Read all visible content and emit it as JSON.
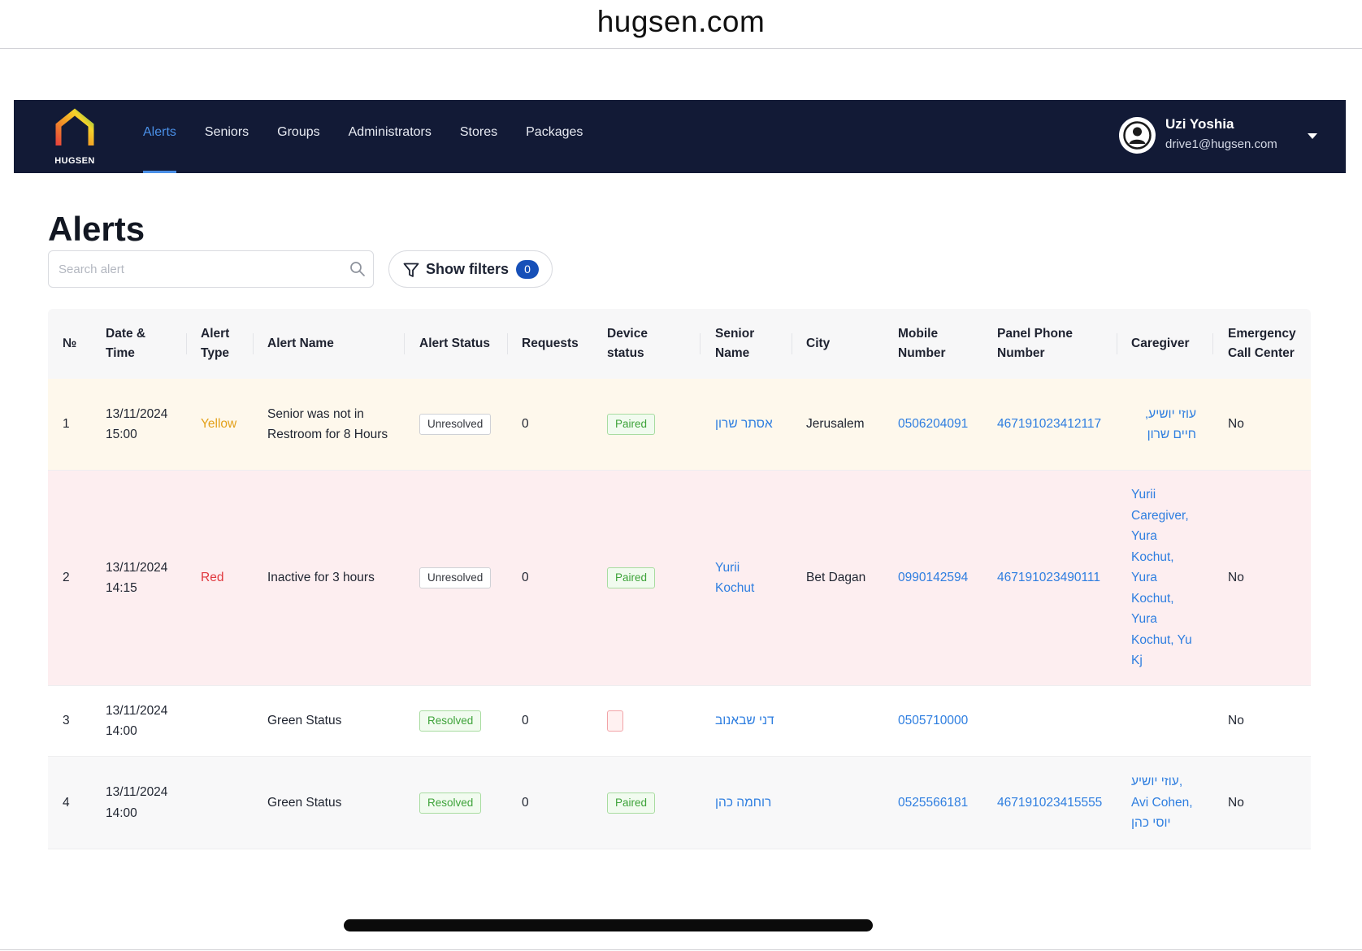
{
  "browser": {
    "url": "hugsen.com"
  },
  "brand": {
    "logo_text": "HUGSEN",
    "nav_bg": "#121a36",
    "accent": "#4a90e8"
  },
  "nav": {
    "items": [
      {
        "label": "Alerts",
        "active": true
      },
      {
        "label": "Seniors",
        "active": false
      },
      {
        "label": "Groups",
        "active": false
      },
      {
        "label": "Administrators",
        "active": false
      },
      {
        "label": "Stores",
        "active": false
      },
      {
        "label": "Packages",
        "active": false
      }
    ]
  },
  "user": {
    "name": "Uzi Yoshia",
    "email": "drive1@hugsen.com",
    "icon": "user-circle-icon"
  },
  "page": {
    "title": "Alerts"
  },
  "search": {
    "placeholder": "Search alert",
    "value": "",
    "icon": "search-icon"
  },
  "filters": {
    "label": "Show filters",
    "count": "0",
    "icon": "filter-icon"
  },
  "table": {
    "columns": [
      {
        "key": "no",
        "label": "№"
      },
      {
        "key": "datetime",
        "label": "Date & Time"
      },
      {
        "key": "type",
        "label": "Alert Type"
      },
      {
        "key": "name",
        "label": "Alert Name"
      },
      {
        "key": "status",
        "label": "Alert Status"
      },
      {
        "key": "requests",
        "label": "Requests"
      },
      {
        "key": "device",
        "label": "Device status"
      },
      {
        "key": "senior",
        "label": "Senior Name"
      },
      {
        "key": "city",
        "label": "City"
      },
      {
        "key": "mobile",
        "label": "Mobile Number"
      },
      {
        "key": "panel",
        "label": "Panel Phone Number"
      },
      {
        "key": "caregiver",
        "label": "Caregiver"
      },
      {
        "key": "ecc",
        "label": "Emergency Call Center"
      }
    ],
    "rows": [
      {
        "no": "1",
        "date": "13/11/2024",
        "time": "15:00",
        "type": "Yellow",
        "name": "Senior was not in Restroom for 8 Hours",
        "status": "Unresolved",
        "requests": "0",
        "device": "Paired",
        "senior": "אסתר שרון",
        "city": "Jerusalem",
        "mobile": "0506204091",
        "panel": "467191023412117",
        "caregiver": "עוזי יושיע, חיים שרון",
        "ecc": "No"
      },
      {
        "no": "2",
        "date": "13/11/2024",
        "time": "14:15",
        "type": "Red",
        "name": "Inactive for 3 hours",
        "status": "Unresolved",
        "requests": "0",
        "device": "Paired",
        "senior": "Yurii Kochut",
        "city": "Bet Dagan",
        "mobile": "0990142594",
        "panel": "467191023490111",
        "caregiver": "Yurii Caregiver, Yura Kochut, Yura Kochut, Yura Kochut, Yu Kj",
        "ecc": "No"
      },
      {
        "no": "3",
        "date": "13/11/2024",
        "time": "14:00",
        "type": "",
        "name": "Green Status",
        "status": "Resolved",
        "requests": "0",
        "device": "",
        "senior": "דני שבאנוב",
        "city": "",
        "mobile": "0505710000",
        "panel": "",
        "caregiver": "",
        "ecc": "No"
      },
      {
        "no": "4",
        "date": "13/11/2024",
        "time": "14:00",
        "type": "",
        "name": "Green Status",
        "status": "Resolved",
        "requests": "0",
        "device": "Paired",
        "senior": "רוחמה כהן",
        "city": "",
        "mobile": "0525566181",
        "panel": "467191023415555",
        "caregiver": "עוזי יושיע, Avi Cohen, יוסי כהן",
        "ecc": "No"
      }
    ]
  }
}
